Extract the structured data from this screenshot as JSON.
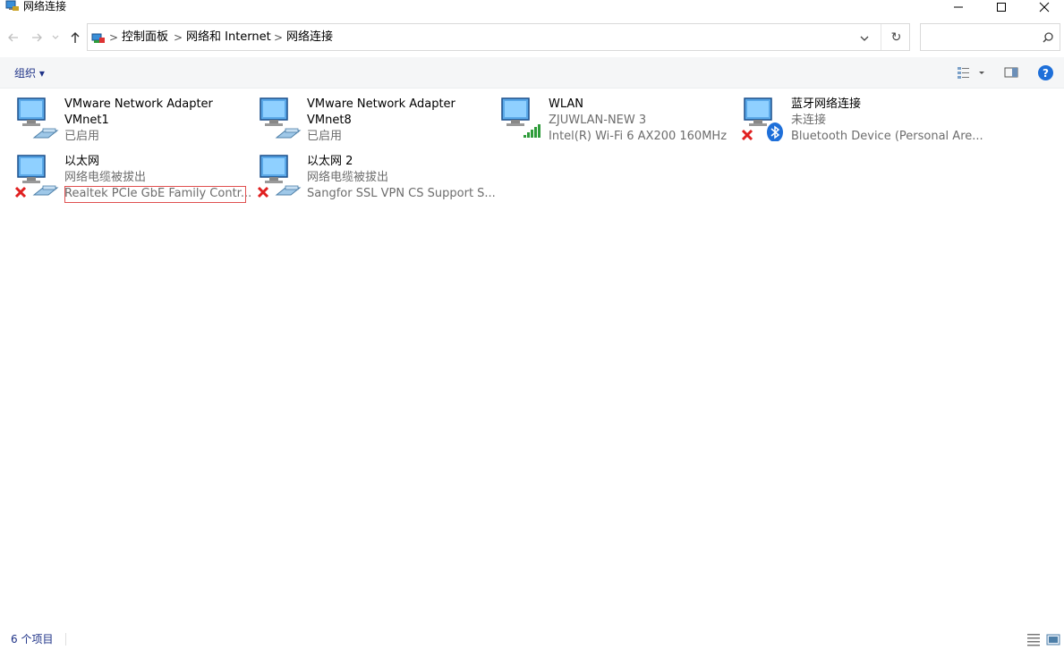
{
  "window": {
    "title": "网络连接"
  },
  "address": {
    "crumbs": [
      "控制面板",
      "网络和 Internet",
      "网络连接"
    ],
    "sep": ">",
    "refresh_glyph": "↻"
  },
  "search": {
    "placeholder": ""
  },
  "toolbar": {
    "organize_label": "组织 ▾"
  },
  "help_glyph": "?",
  "items": [
    {
      "name": "VMware Network Adapter",
      "name2": "VMnet1",
      "status": "已启用",
      "device": "",
      "icon": "ethernet-adapter-icon",
      "state": "enabled"
    },
    {
      "name": "VMware Network Adapter",
      "name2": "VMnet8",
      "status": "已启用",
      "device": "",
      "icon": "ethernet-adapter-icon",
      "state": "enabled"
    },
    {
      "name": "WLAN",
      "name2": "",
      "status": "ZJUWLAN-NEW 3",
      "device": "Intel(R) Wi-Fi 6 AX200 160MHz",
      "icon": "wifi-adapter-icon",
      "state": "connected"
    },
    {
      "name": "蓝牙网络连接",
      "name2": "",
      "status": "未连接",
      "device": "Bluetooth Device (Personal Are...",
      "icon": "bluetooth-adapter-icon",
      "state": "disconnected"
    },
    {
      "name": "以太网",
      "name2": "",
      "status": "网络电缆被拔出",
      "device": "Realtek PCIe GbE Family Contr...",
      "icon": "ethernet-adapter-icon",
      "state": "unplugged"
    },
    {
      "name": "以太网 2",
      "name2": "",
      "status": "网络电缆被拔出",
      "device": "Sangfor SSL VPN CS Support S...",
      "icon": "ethernet-adapter-icon",
      "state": "unplugged"
    }
  ],
  "statusbar": {
    "count": "6 个项目"
  },
  "colors": {
    "accent": "#1e3287",
    "error": "#e02020",
    "wifi": "#2e9c3a",
    "bluetooth": "#1e6fd9"
  }
}
